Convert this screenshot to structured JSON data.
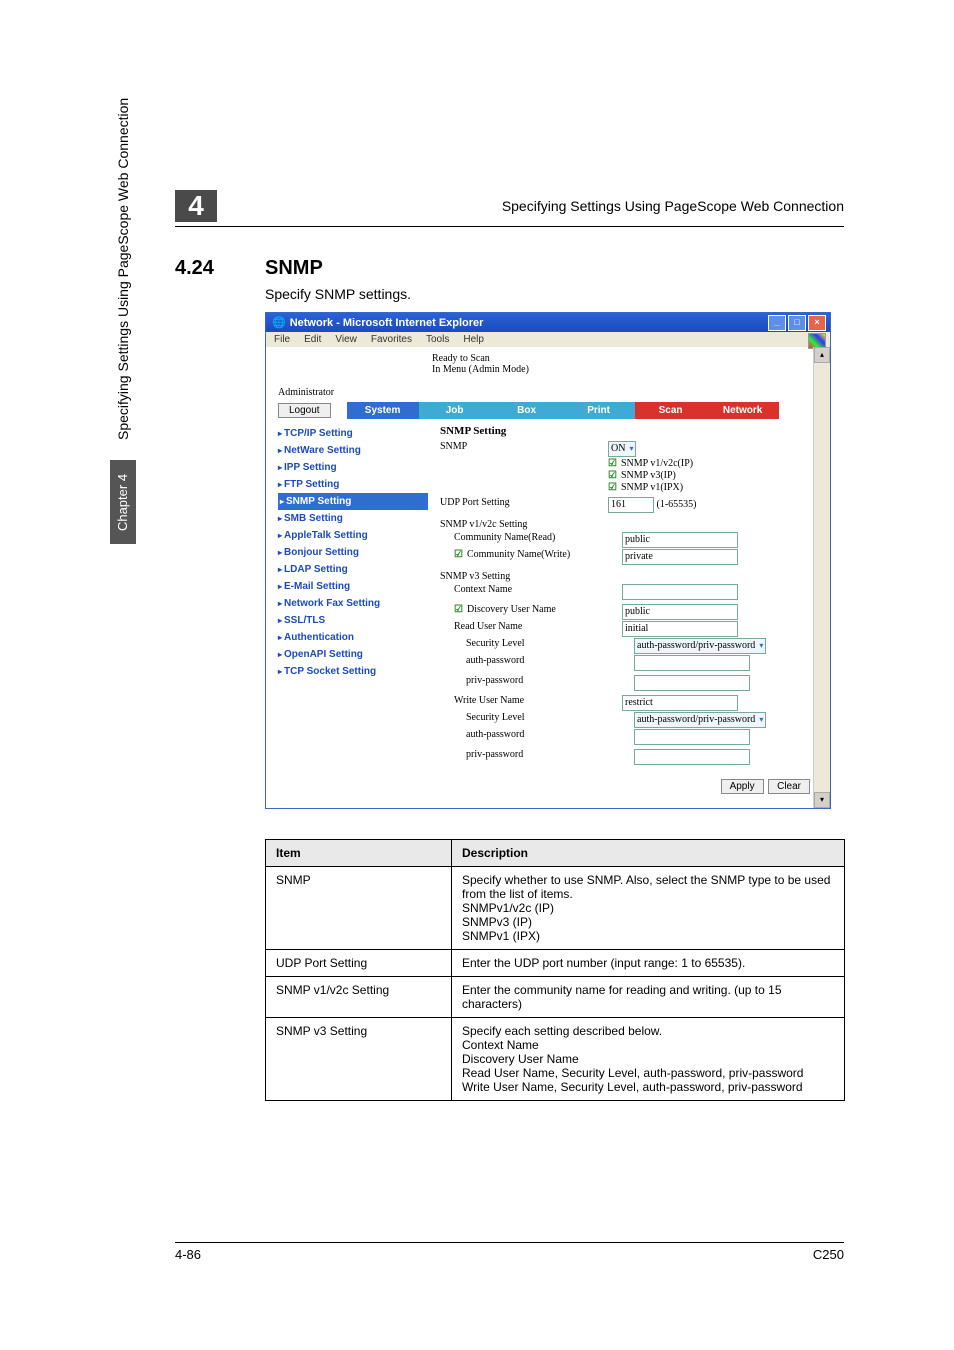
{
  "header": {
    "chapter_number": "4",
    "header_title": "Specifying Settings Using PageScope Web Connection",
    "section_number": "4.24",
    "section_title": "SNMP",
    "intro": "Specify SNMP settings."
  },
  "side": {
    "vertical_text": "Specifying Settings Using PageScope Web Connection",
    "tab_text": "Chapter 4"
  },
  "browser": {
    "title": "Network - Microsoft Internet Explorer",
    "win_min": "_",
    "win_max": "□",
    "win_close": "×",
    "menus": [
      "File",
      "Edit",
      "View",
      "Favorites",
      "Tools",
      "Help"
    ],
    "brand_line1": "Ready to Scan",
    "brand_line2": "In Menu (Admin Mode)",
    "admin_label": "Administrator",
    "logout": "Logout",
    "tabs": [
      "System",
      "Job",
      "Box",
      "Print",
      "Scan",
      "Network"
    ],
    "sidebar_items": [
      "TCP/IP Setting",
      "NetWare Setting",
      "IPP Setting",
      "FTP Setting",
      "SNMP Setting",
      "SMB Setting",
      "AppleTalk Setting",
      "Bonjour Setting",
      "LDAP Setting",
      "E-Mail Setting",
      "Network Fax Setting",
      "SSL/TLS",
      "Authentication",
      "OpenAPI Setting",
      "TCP Socket Setting"
    ],
    "panel_title": "SNMP Setting",
    "labels": {
      "snmp": "SNMP",
      "snmp_on": "ON",
      "snmp_v12c_ip": "SNMP v1/v2c(IP)",
      "snmp_v3_ip": "SNMP v3(IP)",
      "snmp_v1_ipx": "SNMP v1(IPX)",
      "udp_port_setting": "UDP Port Setting",
      "udp_port_value": "161",
      "udp_port_range": "(1-65535)",
      "v12c_section": "SNMP v1/v2c Setting",
      "comm_read": "Community Name(Read)",
      "comm_read_val": "public",
      "comm_write": "Community Name(Write)",
      "comm_write_val": "private",
      "v3_section": "SNMP v3 Setting",
      "ctx_name": "Context Name",
      "disc_user": "Discovery User Name",
      "disc_user_val": "public",
      "read_user": "Read User Name",
      "read_user_val": "initial",
      "sec_level": "Security Level",
      "sec_level_val": "auth-password/priv-password",
      "auth_pass": "auth-password",
      "priv_pass": "priv-password",
      "write_user": "Write User Name",
      "write_user_val": "restrict",
      "apply": "Apply",
      "clear": "Clear"
    }
  },
  "table": {
    "head_item": "Item",
    "head_desc": "Description",
    "rows": [
      {
        "item": "SNMP",
        "desc": "Specify whether to use SNMP. Also, select the SNMP type to be used from the list of items.\nSNMPv1/v2c (IP)\nSNMPv3 (IP)\nSNMPv1 (IPX)"
      },
      {
        "item": "UDP Port Setting",
        "desc": "Enter the UDP port number (input range: 1 to 65535)."
      },
      {
        "item": "SNMP v1/v2c Setting",
        "desc": "Enter the community name for reading and writing. (up to 15 characters)"
      },
      {
        "item": "SNMP v3 Setting",
        "desc": "Specify each setting described below.\nContext Name\nDiscovery User Name\nRead User Name, Security Level, auth-password, priv-password\nWrite User Name, Security Level, auth-password, priv-password"
      }
    ]
  },
  "footer": {
    "left": "4-86",
    "right": "C250"
  }
}
